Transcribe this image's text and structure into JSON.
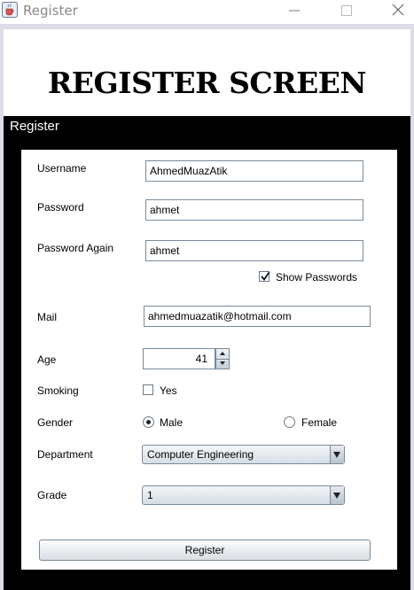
{
  "window": {
    "title": "Register",
    "icon": "java-cup-icon",
    "controls": [
      "minimize-icon",
      "maximize-icon",
      "close-icon"
    ]
  },
  "header": {
    "title": "REGISTER SCREEN"
  },
  "panel": {
    "title": "Register"
  },
  "form": {
    "username": {
      "label": "Username",
      "value": "AhmedMuazAtik"
    },
    "password": {
      "label": "Password",
      "value": "ahmet"
    },
    "password_again": {
      "label": "Password Again",
      "value": "ahmet"
    },
    "show_passwords": {
      "label": "Show Passwords",
      "checked": true
    },
    "mail": {
      "label": "Mail",
      "value": "ahmedmuazatik@hotmail.com"
    },
    "age": {
      "label": "Age",
      "value": "41"
    },
    "smoking": {
      "label": "Smoking",
      "option_label": "Yes",
      "checked": false
    },
    "gender": {
      "label": "Gender",
      "options": [
        "Male",
        "Female"
      ],
      "selected": "Male"
    },
    "department": {
      "label": "Department",
      "selected": "Computer Engineering"
    },
    "grade": {
      "label": "Grade",
      "selected": "1"
    },
    "submit_label": "Register"
  },
  "colors": {
    "panel_background": "#000000",
    "frame": "#dcdde8",
    "title_text": "#8a8a8a"
  }
}
